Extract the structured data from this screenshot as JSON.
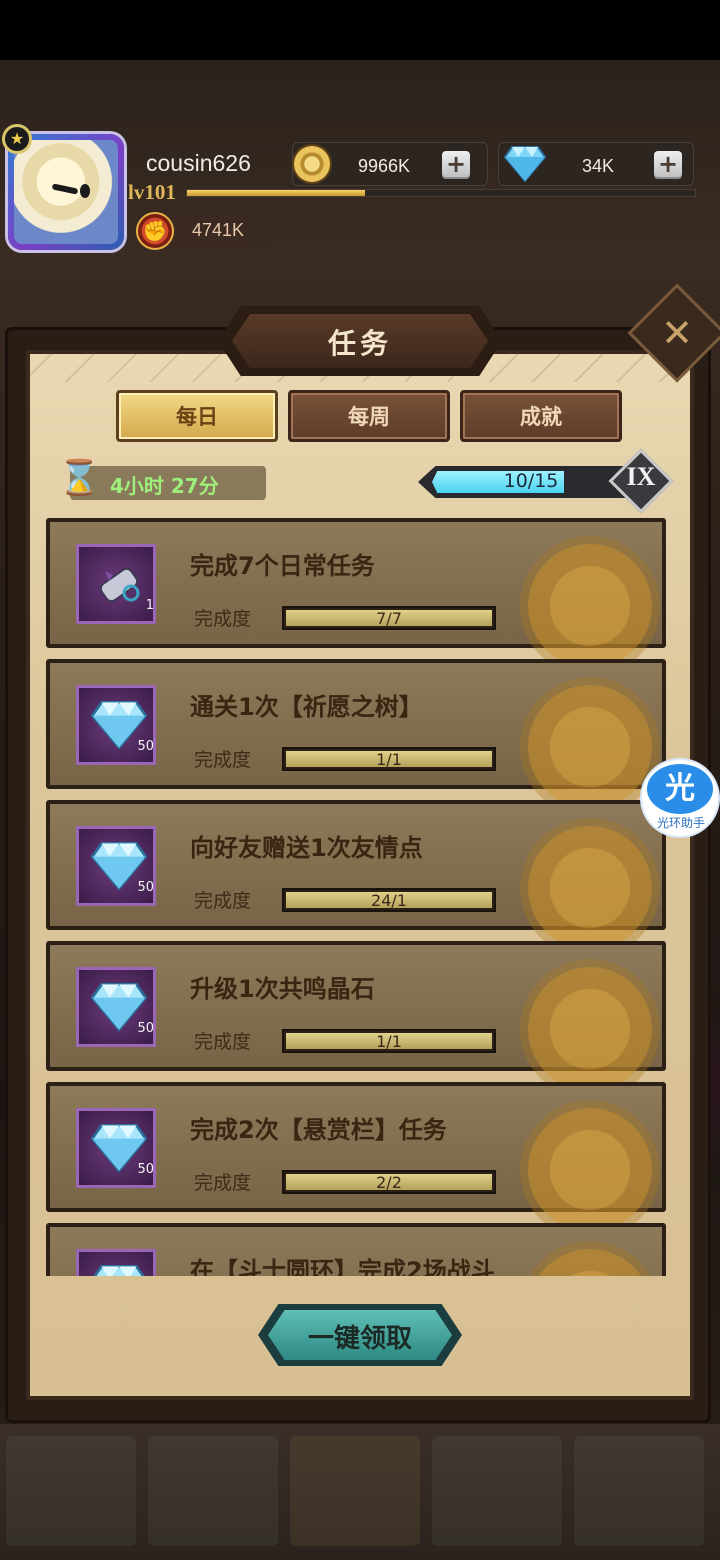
{
  "player": {
    "name": "cousin626",
    "level": "lv101",
    "xp_fraction": 0.35,
    "power": "4741K"
  },
  "resources": {
    "gold": "9966K",
    "diamonds": "34K"
  },
  "panel": {
    "title": "任务",
    "close_icon": "close-icon"
  },
  "tabs": [
    {
      "label": "每日",
      "active": true
    },
    {
      "label": "每周",
      "active": false
    },
    {
      "label": "成就",
      "active": false
    }
  ],
  "timer": "4小时 27分",
  "activity": {
    "current": 10,
    "max": 15,
    "text": "10/15",
    "rank": "IX"
  },
  "tasks": [
    {
      "title": "完成7个日常任务",
      "label": "完成度",
      "progress": "7/7",
      "fraction": 1,
      "reward_icon": "scroll-icon",
      "reward_qty": "1"
    },
    {
      "title": "通关1次【祈愿之树】",
      "label": "完成度",
      "progress": "1/1",
      "fraction": 1,
      "reward_icon": "diamond-icon",
      "reward_qty": "50"
    },
    {
      "title": "向好友赠送1次友情点",
      "label": "完成度",
      "progress": "24/1",
      "fraction": 1,
      "reward_icon": "diamond-icon",
      "reward_qty": "50"
    },
    {
      "title": "升级1次共鸣晶石",
      "label": "完成度",
      "progress": "1/1",
      "fraction": 1,
      "reward_icon": "diamond-icon",
      "reward_qty": "50"
    },
    {
      "title": "完成2次【悬赏栏】任务",
      "label": "完成度",
      "progress": "2/2",
      "fraction": 1,
      "reward_icon": "diamond-icon",
      "reward_qty": "50"
    },
    {
      "title": "在【斗士圆环】完成2场战斗",
      "label": "",
      "progress": "",
      "fraction": 0,
      "reward_icon": "diamond-icon",
      "reward_qty": ""
    }
  ],
  "claim_all_label": "一键领取",
  "helper": {
    "glyph": "光",
    "label": "光环助手"
  },
  "colors": {
    "panel_bg": "#e9d8b2",
    "tab_active": "#f3d886",
    "progress_fill": "#4ad2f0",
    "claim_button": "#5fbfb6"
  }
}
